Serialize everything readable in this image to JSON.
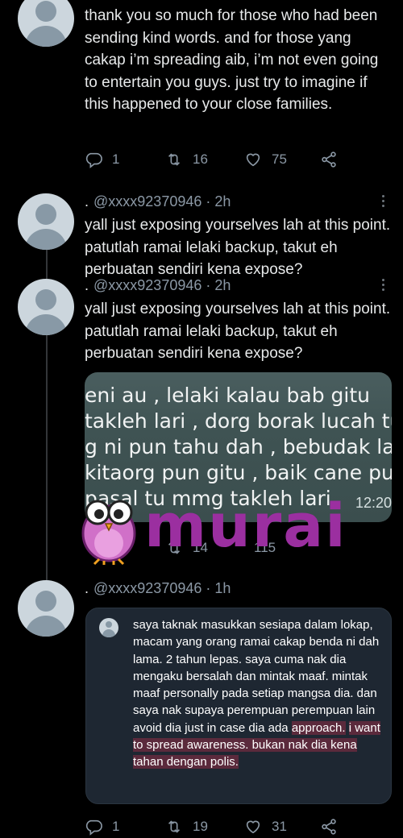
{
  "tweets": [
    {
      "text": "thank you so much for those who had been sending kind words. and for those yang cakap i’m spreading aib, i’m not even going to entertain you guys. just try to imagine if this happened to your close families.",
      "replies": "1",
      "retweets": "16",
      "likes": "75"
    },
    {
      "bullet": ".",
      "handle": "@xxxx92370946 · 2h",
      "text": "yall just exposing yourselves lah at this point. patutlah ramai lelaki backup, takut eh perbuatan sendiri kena expose?"
    },
    {
      "bullet": ".",
      "handle": "@xxxx92370946 · 2h",
      "text": "yall just exposing yourselves lah at this point. patutlah ramai lelaki backup, takut eh perbuatan sendiri kena expose?",
      "media_lines": [
        "eni au , lelaki kalau bab gitu",
        "takleh lari , dorg borak lucah tu",
        "g ni pun tahu dah , bebudak laki",
        "kitaorg pun gitu , baik cane pun",
        "pasal tu mmg takleh lari"
      ],
      "media_time": "12:20",
      "partial_counts": [
        "14",
        "115"
      ]
    },
    {
      "bullet": ".",
      "handle": "@xxxx92370946 · 1h",
      "quote_text": "saya taknak masukkan sesiapa dalam lokap, macam yang orang ramai cakap benda ni dah lama. 2 tahun lepas. saya cuma nak dia mengaku bersalah dan mintak maaf. mintak maaf personally pada setiap mangsa dia. dan saya nak supaya perempuan perempuan lain avoid dia just in case dia ada",
      "quote_highlight_1": "approach.",
      "quote_highlight_2": "i want to spread awareness. bukan nak dia kena tahan dengan polis.",
      "replies": "1",
      "retweets": "19",
      "likes": "31"
    }
  ],
  "watermark": {
    "text": "murai"
  },
  "icons": {
    "reply": "reply-icon",
    "retweet": "retweet-icon",
    "like": "heart-icon",
    "share": "share-icon"
  },
  "colors": {
    "background": "#000000",
    "text": "#e7e9ea",
    "muted": "#8b98a5",
    "watermark": "#9b2fa0"
  }
}
